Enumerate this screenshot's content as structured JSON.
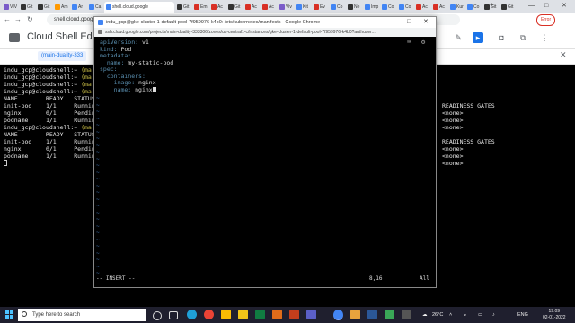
{
  "browser": {
    "tabs": [
      {
        "label": "VIV",
        "color": "#7b5cc9"
      },
      {
        "label": "Git",
        "color": "#333333"
      },
      {
        "label": "Git",
        "color": "#333333"
      },
      {
        "label": "Am",
        "color": "#ff9900"
      },
      {
        "label": "Ar",
        "color": "#4285f4"
      },
      {
        "label": "Ca",
        "color": "#4285f4"
      },
      {
        "label": "",
        "color": "#4285f4",
        "active": true
      },
      {
        "label": "Git",
        "color": "#333333"
      },
      {
        "label": "Em",
        "color": "#d93025"
      },
      {
        "label": "Ac",
        "color": "#d93025"
      },
      {
        "label": "Git",
        "color": "#333333"
      },
      {
        "label": "Ac",
        "color": "#d93025"
      },
      {
        "label": "Ac",
        "color": "#d93025"
      },
      {
        "label": "Viv",
        "color": "#7b5cc9"
      },
      {
        "label": "Kit",
        "color": "#4285f4"
      },
      {
        "label": "Ev",
        "color": "#d93025"
      },
      {
        "label": "Co",
        "color": "#4285f4"
      },
      {
        "label": "Ne",
        "color": "#333333"
      },
      {
        "label": "Imp",
        "color": "#4285f4"
      },
      {
        "label": "Co",
        "color": "#4285f4"
      },
      {
        "label": "Co",
        "color": "#4285f4"
      },
      {
        "label": "Ac",
        "color": "#d93025"
      },
      {
        "label": "Ac",
        "color": "#d93025"
      },
      {
        "label": "Kur",
        "color": "#4285f4"
      },
      {
        "label": "Co",
        "color": "#4285f4"
      },
      {
        "label": "Git",
        "color": "#333333"
      },
      {
        "label": "Git",
        "color": "#333333"
      }
    ],
    "address": "shell.cloud.google",
    "error_label": "Error"
  },
  "cloudshell": {
    "title": "Cloud Shell Editor",
    "project": "(main-duality-333"
  },
  "terminal": {
    "lines": [
      {
        "prompt": "indu_gcp@cloudshell:~",
        "project": "(ma"
      },
      {
        "prompt": "indu_gcp@cloudshell:~",
        "project": "(ma"
      },
      {
        "prompt": "indu_gcp@cloudshell:~",
        "project": "(ma"
      },
      {
        "prompt": "indu_gcp@cloudshell:~",
        "project": "(ma"
      },
      {
        "text": "NAME        READY   STATUS"
      },
      {
        "text": "init-pod    1/1     Runnin"
      },
      {
        "text": "nginx       0/1     Pendin"
      },
      {
        "text": "podname     1/1     Runnin"
      },
      {
        "prompt": "indu_gcp@cloudshell:~",
        "project": "(ma"
      },
      {
        "text": "NAME        READY   STATUS"
      },
      {
        "text": "init-pod    1/1     Runnin"
      },
      {
        "text": "nginx       0/1     Pendin"
      },
      {
        "text": "podname     1/1     Runnin"
      }
    ],
    "right_lines": [
      "READINESS GATES",
      "<none>",
      "<none>",
      "<none>",
      "",
      "READINESS GATES",
      "<none>",
      "<none>",
      "<none>"
    ]
  },
  "ssh_window": {
    "title": "ssh.cloud.google.com/projects/main-duality-333306/zones/us-central1-c/instances/gke-cluster-1-default-pool-7f959976-k4b0?authuser=... - Google Chrome",
    "title_short": "indu_gcp@gke-cluster-1-default-pool-7f959976-k4b0: /etc/kubernetes/manifests - Google Chrome",
    "url": "ssh.cloud.google.com/projects/main-duality-333306/zones/us-central1-c/instances/gke-cluster-1-default-pool-7f959976-k4b0?authuser...",
    "vim_lines": [
      {
        "key": "apiVersion:",
        "val": " v1"
      },
      {
        "key": "kind:",
        "val": " Pod"
      },
      {
        "key": "metadata:",
        "val": ""
      },
      {
        "key": "  name:",
        "val": " my-static-pod"
      },
      {
        "key": "spec:",
        "val": ""
      },
      {
        "key": "  containers:",
        "val": ""
      },
      {
        "key": "  - image:",
        "val": " nginx"
      },
      {
        "key": "    name:",
        "val": " nginx"
      }
    ],
    "vim_mode": "-- INSERT --",
    "vim_position": "8,16",
    "vim_scroll": "All"
  },
  "taskbar": {
    "search_placeholder": "Type here to search",
    "weather": "26°C",
    "language": "ENG",
    "time": "19:09",
    "date": "02-01-2022"
  }
}
